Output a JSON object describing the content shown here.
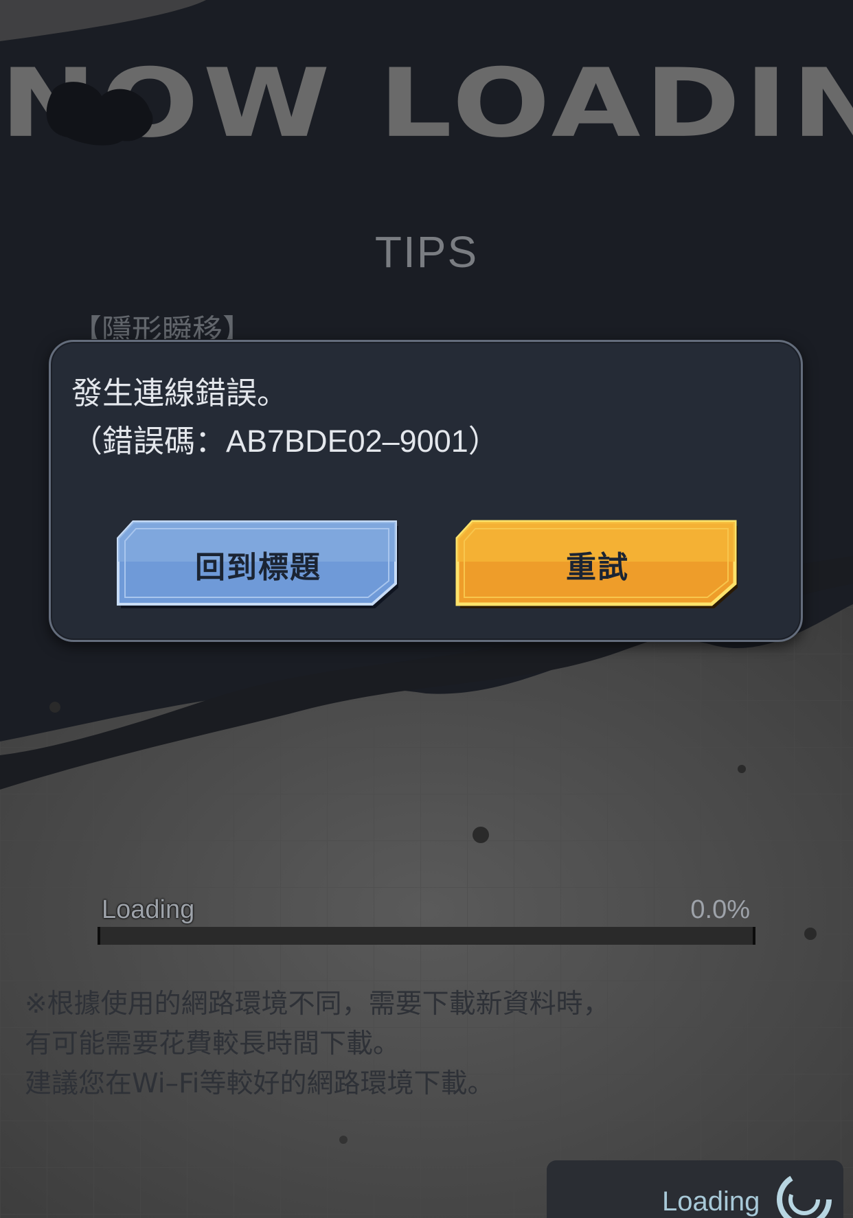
{
  "header": {
    "title": "NOW LOADING",
    "tips_heading": "TIPS",
    "tip_title": "【隱形瞬移】"
  },
  "dialog": {
    "message": "發生連線錯誤。",
    "error_code": "（錯誤碼：AB7BDE02–9001）",
    "back_button": "回到標題",
    "retry_button": "重試"
  },
  "loading": {
    "label": "Loading",
    "percent_text": "0.0%",
    "progress": 0.0
  },
  "notes": {
    "line1": "※根據使用的網路環境不同，需要下載新資料時，",
    "line2": "有可能需要花費較長時間下載。",
    "line3": "建議您在Wi–Fi等較好的網路環境下載。"
  },
  "spinner": {
    "label": "Loading"
  },
  "colors": {
    "dialog_bg": "#252b36",
    "back_button": "#6f9ad8",
    "retry_button": "#f2a72b"
  }
}
